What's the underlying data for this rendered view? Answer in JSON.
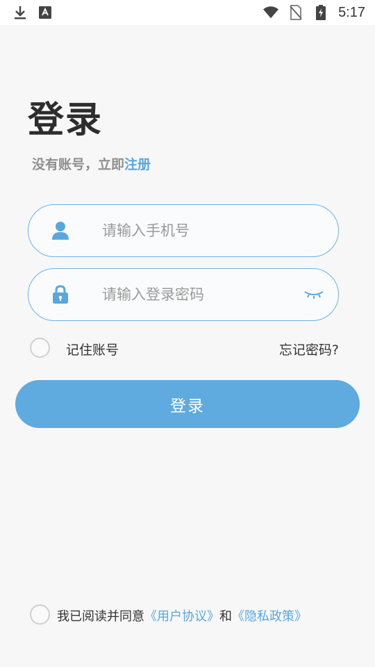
{
  "status_bar": {
    "time": "5:17",
    "icons": [
      "download-icon",
      "keyboard-a-icon",
      "wifi-icon",
      "no-sim-icon",
      "battery-charging-icon"
    ]
  },
  "login": {
    "title": "登录",
    "no_account_text": "没有账号，立即",
    "register_link": "注册",
    "phone_placeholder": "请输入手机号",
    "password_placeholder": "请输入登录密码",
    "remember_label": "记住账号",
    "forgot_label": "忘记密码?",
    "submit_label": "登录"
  },
  "agreement": {
    "prefix": "我已阅读并同意",
    "user_agreement": "《用户协议》",
    "and": "和",
    "privacy_policy": "《隐私政策》"
  },
  "colors": {
    "accent": "#5faade",
    "link": "#5aa7dc",
    "input_border": "#6db1e0",
    "background": "#f7f7f8"
  }
}
